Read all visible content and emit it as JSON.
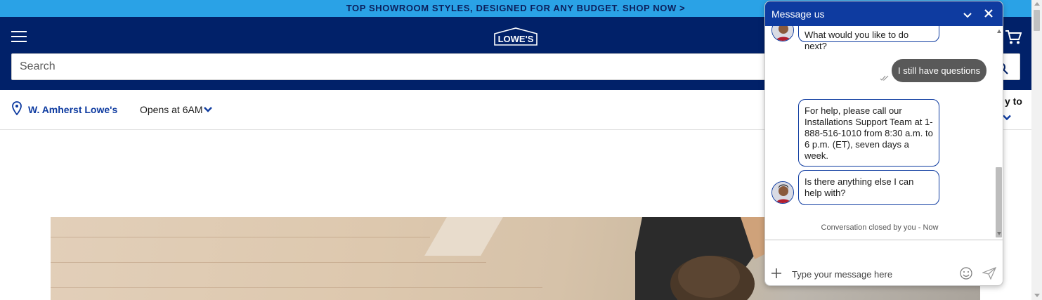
{
  "promo": {
    "text": "TOP SHOWROOM STYLES, DESIGNED FOR ANY BUDGET. SHOP NOW >"
  },
  "header": {
    "logo_text": "LOWE'S",
    "search": {
      "placeholder": "Search",
      "value": ""
    }
  },
  "store": {
    "name": "W. Amherst Lowe's",
    "hours": "Opens at 6AM",
    "delivery_label": "y to"
  },
  "chat": {
    "title": "Message us",
    "messages": [
      {
        "from": "agent",
        "text": "What would you like to do next?"
      },
      {
        "from": "user",
        "text": "I still have questions"
      },
      {
        "from": "agent",
        "text": "For help, please call our Installations Support Team at 1-888-516-1010 from 8:30 a.m. to 6 p.m. (ET), seven days a week."
      },
      {
        "from": "agent",
        "text": "Is there anything else I can help with?"
      }
    ],
    "closed_note": "Conversation closed by you  - Now",
    "input": {
      "placeholder": "Type your message here",
      "value": ""
    }
  },
  "colors": {
    "brand_blue": "#012169",
    "promo_blue": "#2aa2e6",
    "chat_header": "#0e3ba0",
    "user_bubble": "#595959"
  },
  "icons": [
    "menu-icon",
    "cart-icon",
    "search-icon",
    "location-pin-icon",
    "chevron-down-icon",
    "minimize-icon",
    "close-icon",
    "plus-icon",
    "emoji-icon",
    "send-icon"
  ]
}
